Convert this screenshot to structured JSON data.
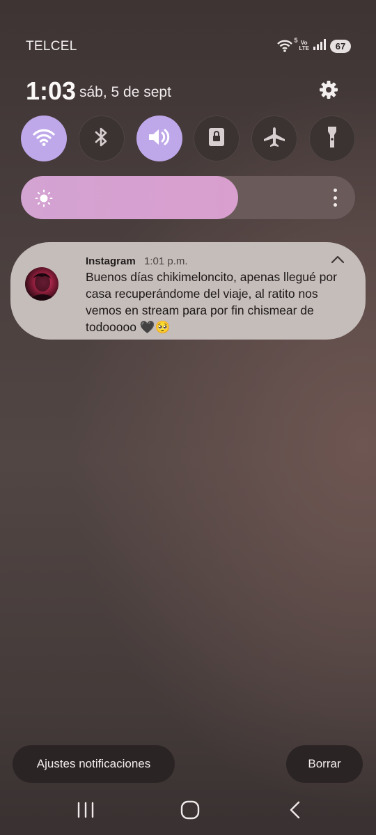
{
  "status_bar": {
    "carrier": "TELCEL",
    "wifi_badge": "5",
    "network_top": "Vo",
    "network_bottom": "LTE",
    "battery": "67"
  },
  "header": {
    "time": "1:03",
    "date": "sáb, 5 de sept"
  },
  "quick_settings": {
    "toggles": [
      {
        "icon": "wifi-icon",
        "state": "on"
      },
      {
        "icon": "bluetooth-icon",
        "state": "off"
      },
      {
        "icon": "sound-icon",
        "state": "on"
      },
      {
        "icon": "screen-lock-icon",
        "state": "off"
      },
      {
        "icon": "airplane-icon",
        "state": "off"
      },
      {
        "icon": "flashlight-icon",
        "state": "off"
      }
    ],
    "brightness_level": 0.65
  },
  "notification": {
    "app": "Instagram",
    "time": "1:01 p.m.",
    "message": "Buenos días chikimeloncito, apenas llegué por casa recuperándome del viaje, al ratito nos vemos en stream para por fin chismear de todooooo 🖤🥺"
  },
  "actions": {
    "settings_label": "Ajustes notificaciones",
    "clear_label": "Borrar"
  },
  "colors": {
    "accent_on": "#bfa8ea",
    "brightness_fill": "#d3a3d2",
    "notification_bg": "#c5bdba"
  }
}
